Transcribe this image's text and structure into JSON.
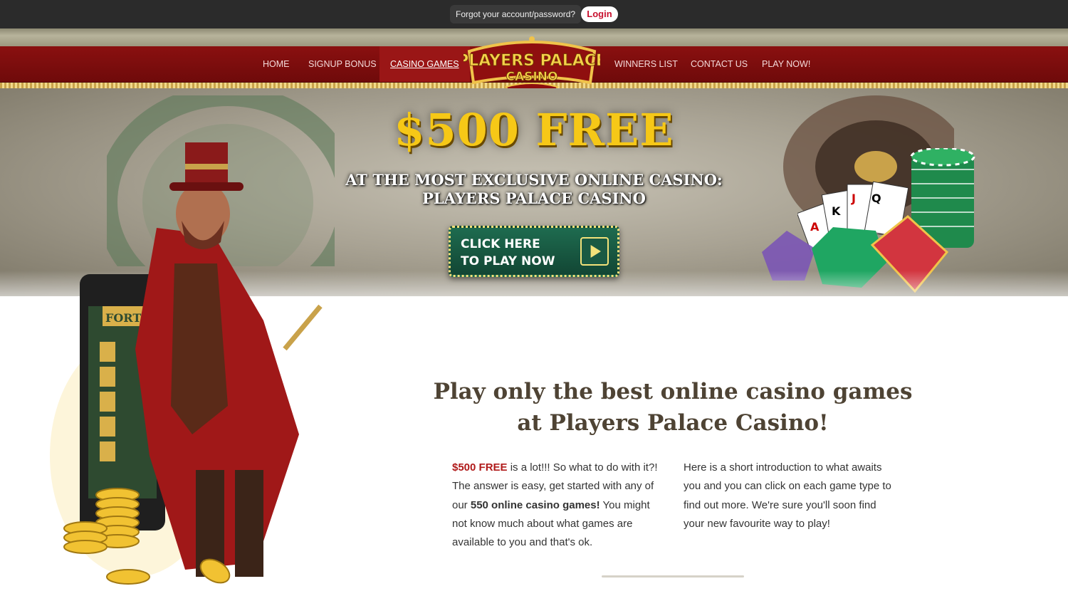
{
  "topbar": {
    "forgot_label": "Forgot your account/password?",
    "login_label": "Login"
  },
  "nav": {
    "items": [
      {
        "label": "HOME"
      },
      {
        "label": "SIGNUP BONUS"
      },
      {
        "label": "CASINO GAMES"
      },
      {
        "label": "WINNERS LIST"
      },
      {
        "label": "CONTACT US"
      },
      {
        "label": "PLAY NOW!"
      }
    ],
    "active": "CASINO GAMES"
  },
  "logo": {
    "line1": "PLAYERS PALACE",
    "line2": "CASINO"
  },
  "hero": {
    "title": "$500 FREE",
    "subtitle_line1": "AT THE MOST EXCLUSIVE ONLINE CASINO:",
    "subtitle_line2": "PLAYERS PALACE CASINO",
    "cta_line1": "CLICK HERE",
    "cta_line2": "TO PLAY NOW",
    "phone_label": "FORTU"
  },
  "main": {
    "headline_line1": "Play only the best online casino games",
    "headline_line2": "at Players Palace Casino!",
    "left_para": {
      "highlight": "$500 FREE",
      "text1": " is a lot!!! So what to do with it?! The answer is easy, get started with any of our ",
      "bold": "550 online casino games!",
      "text2": " You might not know much about what games are available to you and that's ok."
    },
    "right_para": "Here is a short introduction to what awaits you and you can click on each game type to find out more. We're sure you'll soon find your new favourite way to play!"
  },
  "colors": {
    "nav_red": "#7d0d0d",
    "gold": "#f6c817",
    "cta_green": "#1e6b4f",
    "login_red": "#c8102e",
    "headline_brown": "#4e4334",
    "highlight_red": "#b01a1a"
  }
}
